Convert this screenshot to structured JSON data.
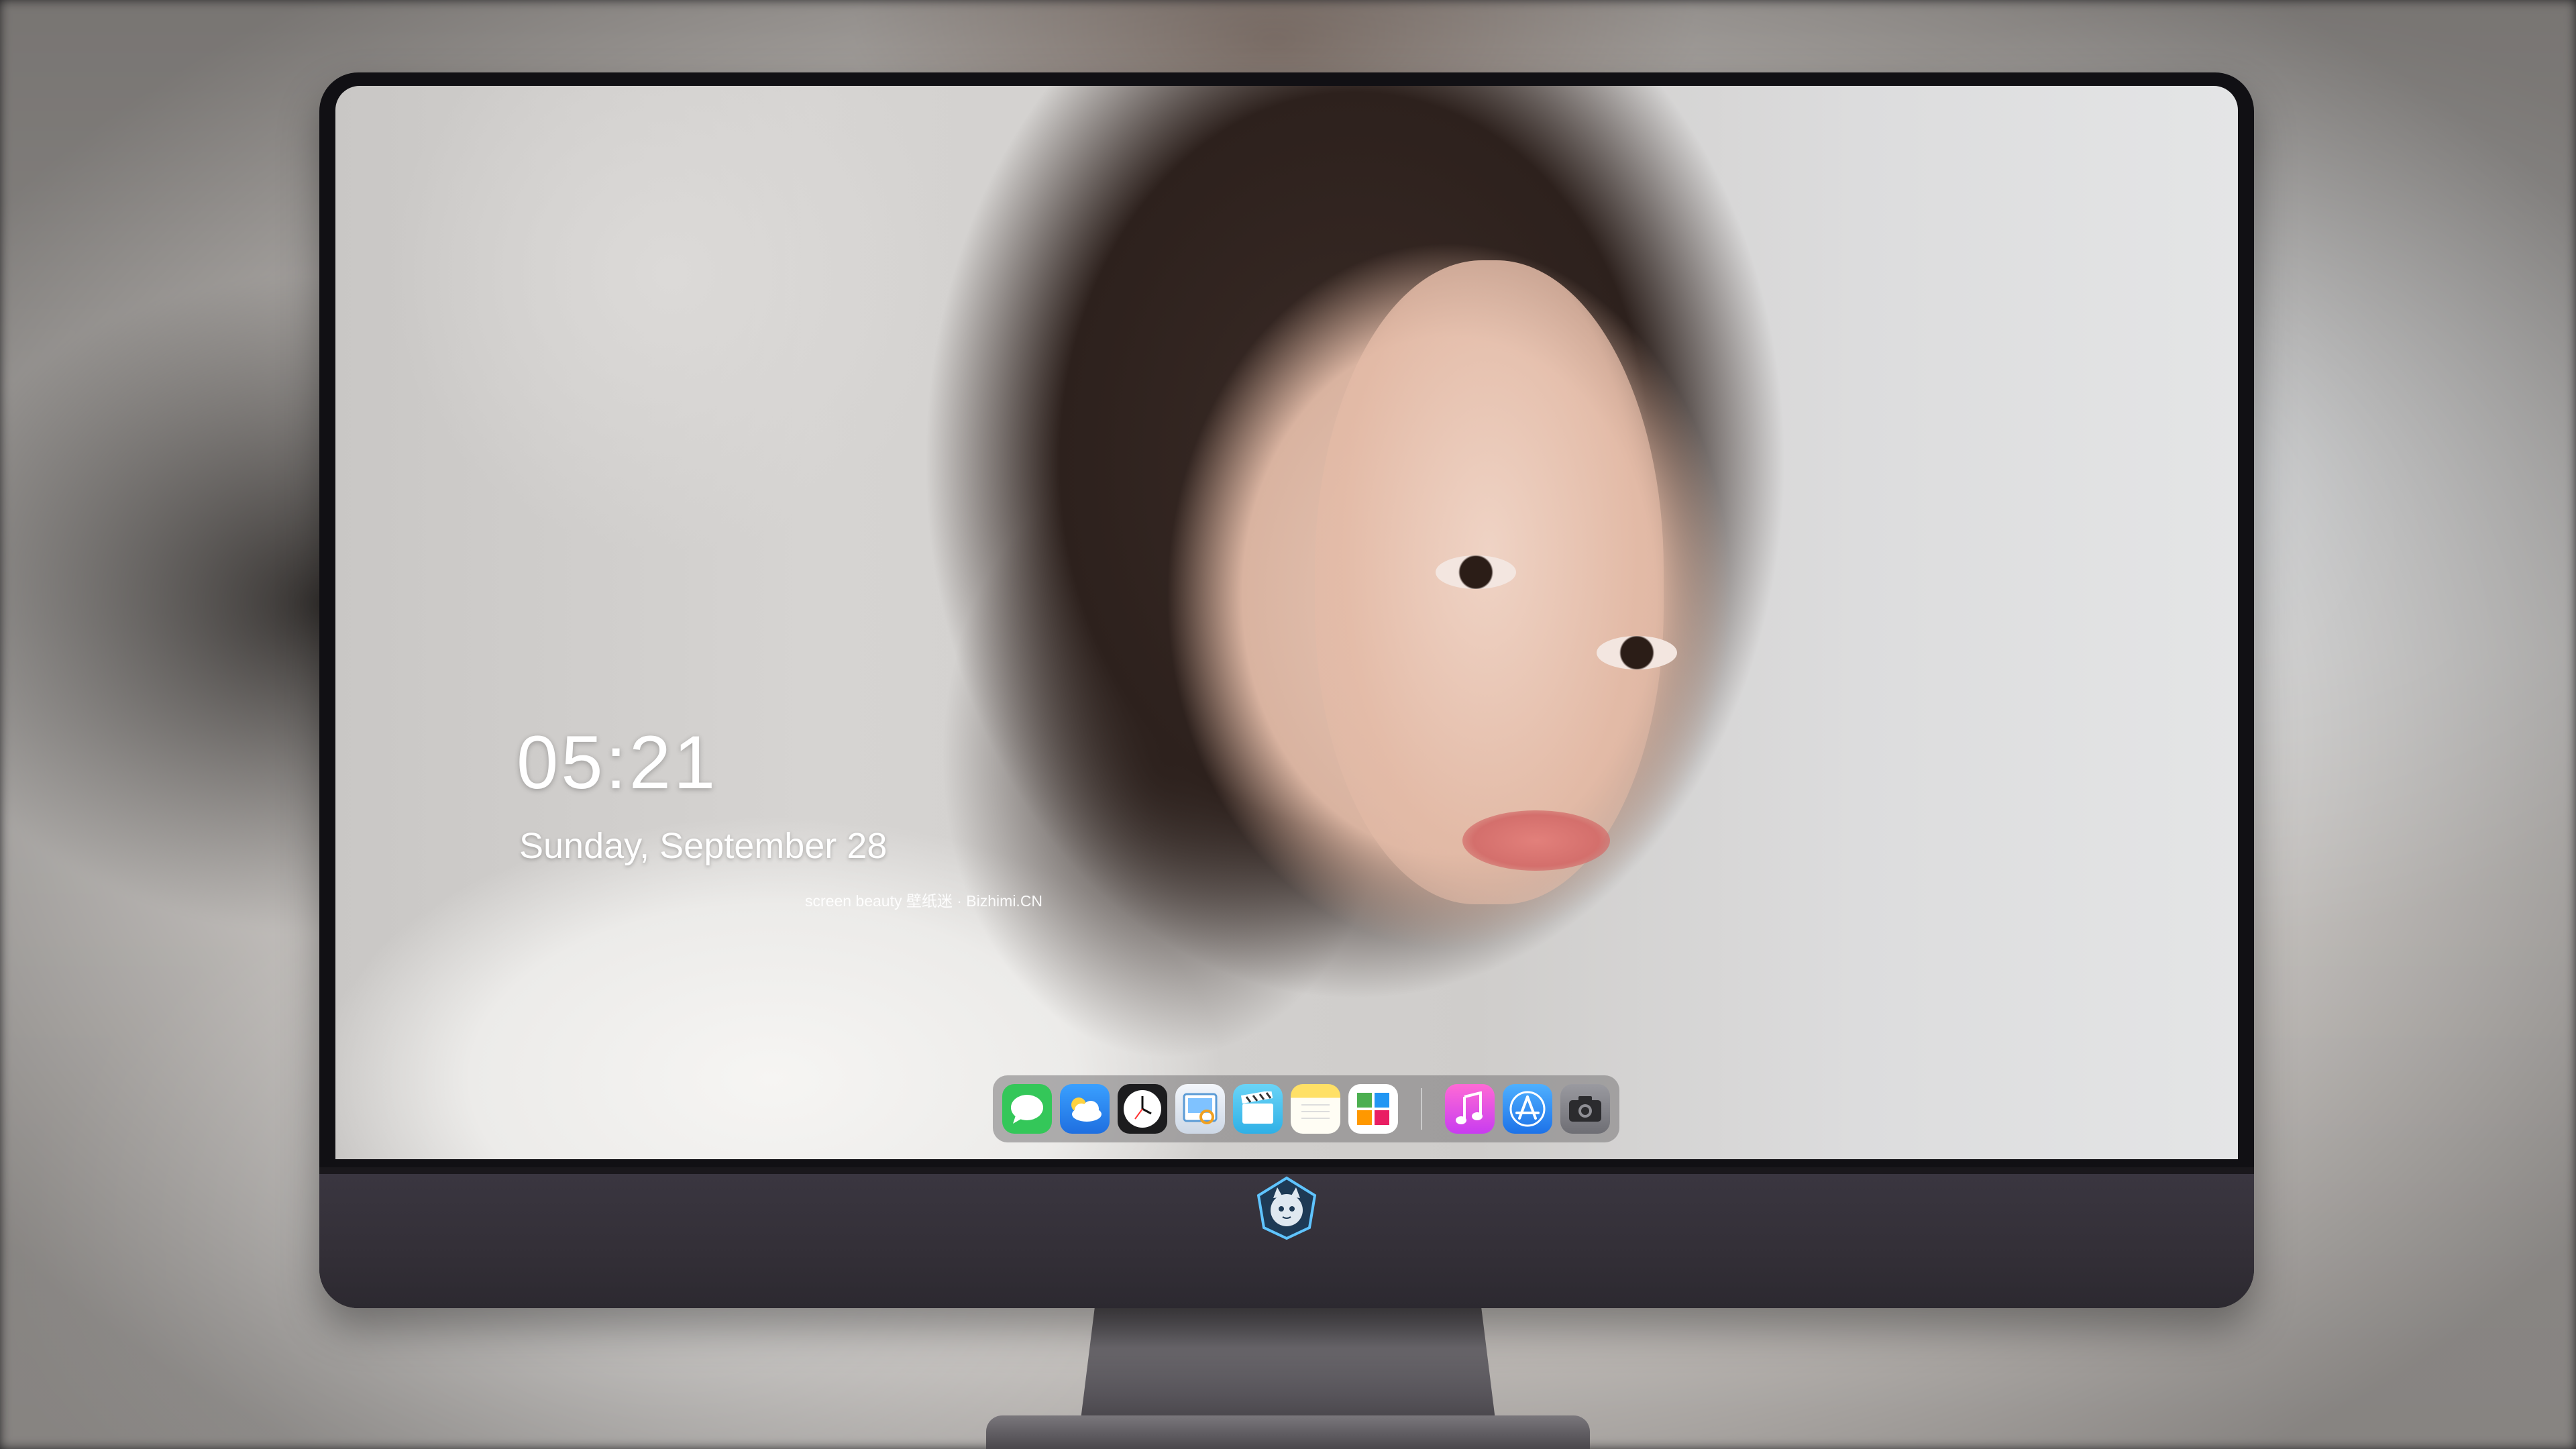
{
  "wallpaper": {
    "credit": "screen beauty 壁纸迷 · Bizhimi.CN"
  },
  "clock": {
    "time": "05:21",
    "date": "Sunday, September  28"
  },
  "dock": {
    "apps": [
      {
        "name": "Messages",
        "icon": "messages-icon",
        "color": "#34c759"
      },
      {
        "name": "Weather",
        "icon": "weather-icon",
        "color": "#2a8cf0"
      },
      {
        "name": "Clock",
        "icon": "clock-icon",
        "color": "#1c1c1e"
      },
      {
        "name": "Preview",
        "icon": "preview-icon",
        "color": "#e8eef6"
      },
      {
        "name": "Clips",
        "icon": "clapperboard-icon",
        "color": "#4cc4f0"
      },
      {
        "name": "Notes",
        "icon": "notes-icon",
        "color": "#ffd60a"
      },
      {
        "name": "Photo Booth",
        "icon": "photo-gallery-icon",
        "color": "#ffffff"
      }
    ],
    "pinned": [
      {
        "name": "Music",
        "icon": "music-note-icon",
        "color": "#fa2db0"
      },
      {
        "name": "App Store",
        "icon": "app-store-icon",
        "color": "#1e90ff"
      },
      {
        "name": "Camera",
        "icon": "camera-icon",
        "color": "#8e8e93"
      }
    ]
  },
  "monitor": {
    "logo_icon": "cat-mascot-logo-icon"
  }
}
